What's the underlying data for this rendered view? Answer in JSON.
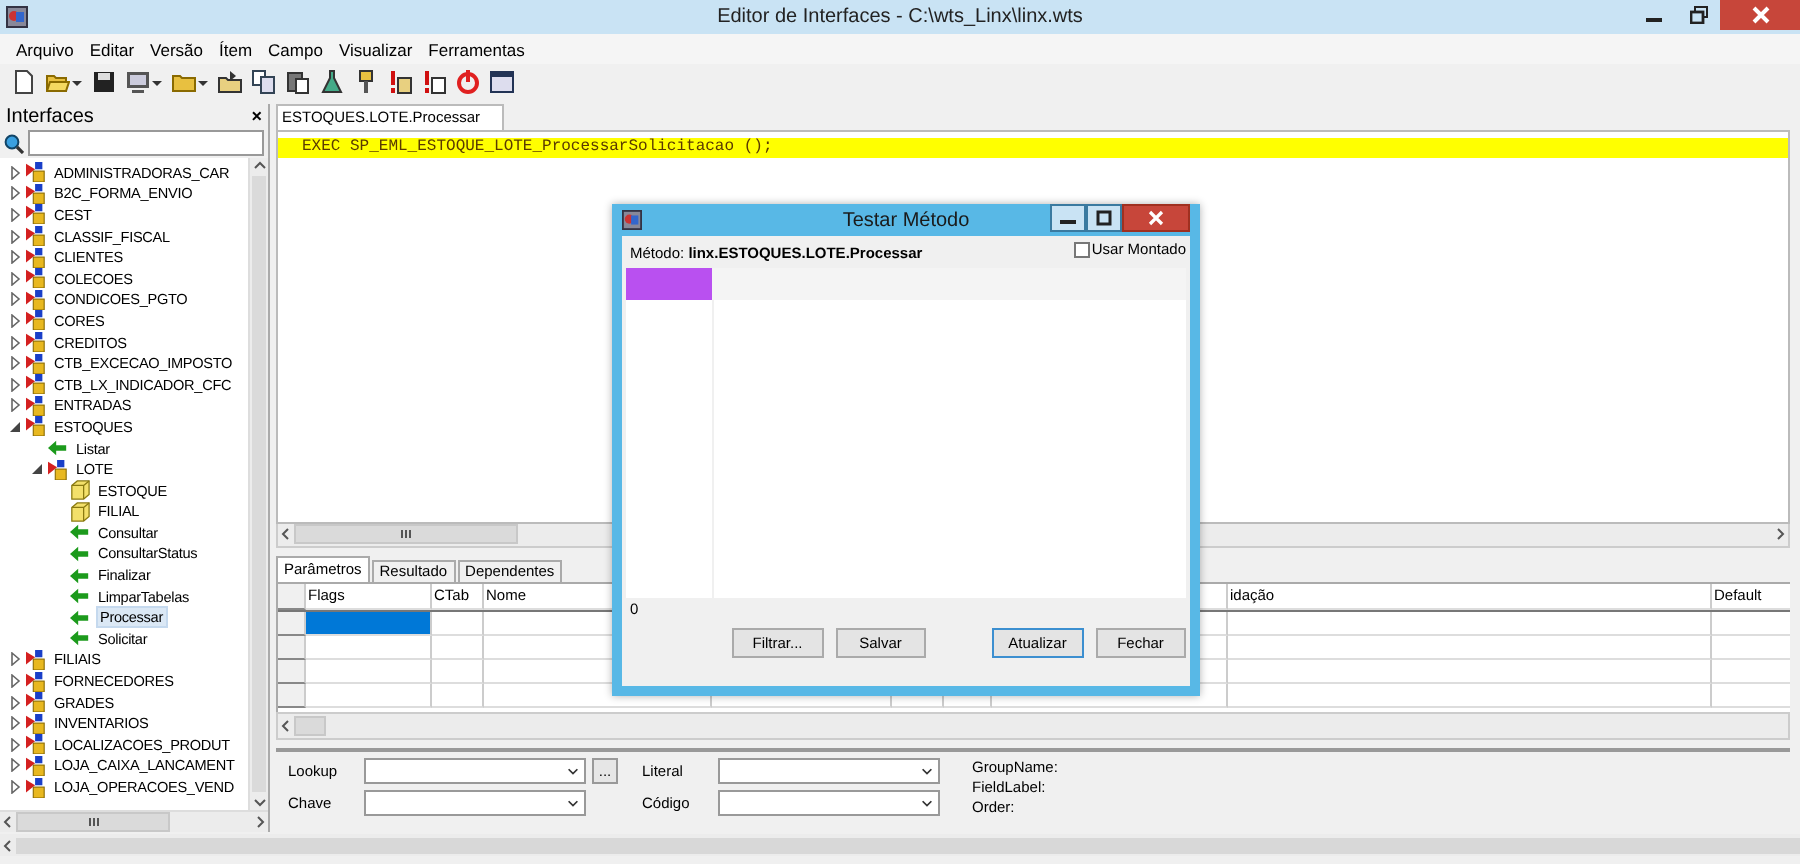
{
  "window": {
    "title": "Editor de Interfaces - C:\\wts_Linx\\linx.wts"
  },
  "menu": [
    "Arquivo",
    "Editar",
    "Versão",
    "Ítem",
    "Campo",
    "Visualizar",
    "Ferramentas"
  ],
  "sidebar": {
    "title": "Interfaces",
    "close": "×",
    "tree": [
      {
        "label": "ADMINISTRADORAS_CAR",
        "kind": "interface",
        "expanded": false,
        "selected": false
      },
      {
        "label": "B2C_FORMA_ENVIO",
        "kind": "interface",
        "expanded": false,
        "selected": false
      },
      {
        "label": "CEST",
        "kind": "interface",
        "expanded": false,
        "selected": false
      },
      {
        "label": "CLASSIF_FISCAL",
        "kind": "interface",
        "expanded": false,
        "selected": false
      },
      {
        "label": "CLIENTES",
        "kind": "interface",
        "expanded": false,
        "selected": false
      },
      {
        "label": "COLECOES",
        "kind": "interface",
        "expanded": false,
        "selected": false
      },
      {
        "label": "CONDICOES_PGTO",
        "kind": "interface",
        "expanded": false,
        "selected": false
      },
      {
        "label": "CORES",
        "kind": "interface",
        "expanded": false,
        "selected": false
      },
      {
        "label": "CREDITOS",
        "kind": "interface",
        "expanded": false,
        "selected": false
      },
      {
        "label": "CTB_EXCECAO_IMPOSTO",
        "kind": "interface",
        "expanded": false,
        "selected": false
      },
      {
        "label": "CTB_LX_INDICADOR_CFC",
        "kind": "interface",
        "expanded": false,
        "selected": false
      },
      {
        "label": "ENTRADAS",
        "kind": "interface",
        "expanded": false,
        "selected": false
      },
      {
        "label": "ESTOQUES",
        "kind": "interface",
        "expanded": true,
        "selected": false,
        "children": [
          {
            "label": "Listar",
            "kind": "method",
            "selected": false
          },
          {
            "label": "LOTE",
            "kind": "interface",
            "expanded": true,
            "selected": false,
            "children": [
              {
                "label": "ESTOQUE",
                "kind": "table",
                "selected": false
              },
              {
                "label": "FILIAL",
                "kind": "table",
                "selected": false
              },
              {
                "label": "Consultar",
                "kind": "method",
                "selected": false
              },
              {
                "label": "ConsultarStatus",
                "kind": "method",
                "selected": false
              },
              {
                "label": "Finalizar",
                "kind": "method",
                "selected": false
              },
              {
                "label": "LimparTabelas",
                "kind": "method",
                "selected": false
              },
              {
                "label": "Processar",
                "kind": "method",
                "selected": true
              },
              {
                "label": "Solicitar",
                "kind": "method",
                "selected": false
              }
            ]
          }
        ]
      },
      {
        "label": "FILIAIS",
        "kind": "interface",
        "expanded": false,
        "selected": false
      },
      {
        "label": "FORNECEDORES",
        "kind": "interface",
        "expanded": false,
        "selected": false
      },
      {
        "label": "GRADES",
        "kind": "interface",
        "expanded": false,
        "selected": false
      },
      {
        "label": "INVENTARIOS",
        "kind": "interface",
        "expanded": false,
        "selected": false
      },
      {
        "label": "LOCALIZACOES_PRODUT",
        "kind": "interface",
        "expanded": false,
        "selected": false
      },
      {
        "label": "LOJA_CAIXA_LANCAMENT",
        "kind": "interface",
        "expanded": false,
        "selected": false
      },
      {
        "label": "LOJA_OPERACOES_VEND",
        "kind": "interface",
        "expanded": false,
        "selected": false
      }
    ]
  },
  "editor": {
    "tab": "ESTOQUES.LOTE.Processar",
    "lines": [
      "EXEC SP_EML_ESTOQUE_LOTE_ProcessarSolicitacao ();"
    ]
  },
  "tabs": [
    {
      "label": "Parâmetros",
      "selected": true
    },
    {
      "label": "Resultado",
      "selected": false
    },
    {
      "label": "Dependentes",
      "selected": false
    }
  ],
  "grid": {
    "columns": [
      "Flags",
      "CTab",
      "Nome",
      "idação",
      "Default"
    ],
    "rows": [
      {
        "selected": true
      },
      {
        "selected": false
      },
      {
        "selected": false
      },
      {
        "selected": false
      }
    ]
  },
  "form": {
    "lookup": "Lookup",
    "browse": "...",
    "literal": "Literal",
    "chave": "Chave",
    "codigo": "Código",
    "info": [
      "GroupName:",
      "FieldLabel:",
      "Order:"
    ]
  },
  "dialog": {
    "title": "Testar Método",
    "method": "Método: **linx.ESTOQUES.LOTE.Processar**",
    "use_mounted": {
      "label": "Usar Montado",
      "checked": false
    },
    "count": "0",
    "buttons": [
      {
        "label": "Filtrar...",
        "default": false
      },
      {
        "label": "Salvar",
        "default": false
      },
      {
        "label": "Atualizar",
        "default": true
      },
      {
        "label": "Fechar",
        "default": false
      }
    ]
  }
}
